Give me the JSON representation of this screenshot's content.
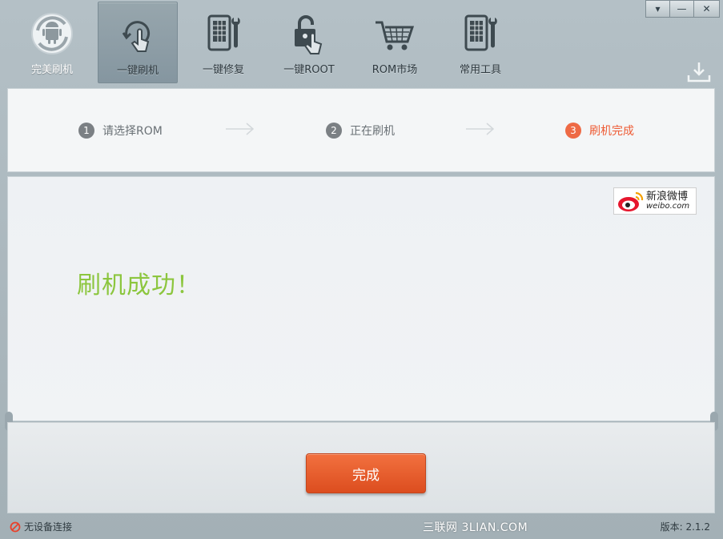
{
  "toolbar": {
    "items": [
      {
        "label": "完美刷机",
        "icon": "android-refresh-icon"
      },
      {
        "label": "一键刷机",
        "icon": "touch-refresh-icon"
      },
      {
        "label": "一键修复",
        "icon": "phone-wrench-icon"
      },
      {
        "label": "一键ROOT",
        "icon": "unlock-touch-icon"
      },
      {
        "label": "ROM市场",
        "icon": "shopping-cart-icon"
      },
      {
        "label": "常用工具",
        "icon": "phone-tools-icon"
      }
    ],
    "active_index": 1
  },
  "window_controls": {
    "menu": "▾",
    "minimize": "—",
    "close": "✕"
  },
  "steps": [
    {
      "num": "1",
      "label": "请选择ROM"
    },
    {
      "num": "2",
      "label": "正在刷机"
    },
    {
      "num": "3",
      "label": "刷机完成"
    }
  ],
  "main": {
    "success_text": "刷机成功！",
    "weibo": {
      "cn": "新浪微博",
      "en": "weibo.com"
    }
  },
  "bottom": {
    "finish_label": "完成"
  },
  "status": {
    "connection": "无设备连接",
    "watermark": "三联网 3LIAN.COM",
    "version": "版本: 2.1.2"
  },
  "colors": {
    "accent": "#ee5a33",
    "success": "#8cc63e",
    "button": "#e85a2a"
  }
}
